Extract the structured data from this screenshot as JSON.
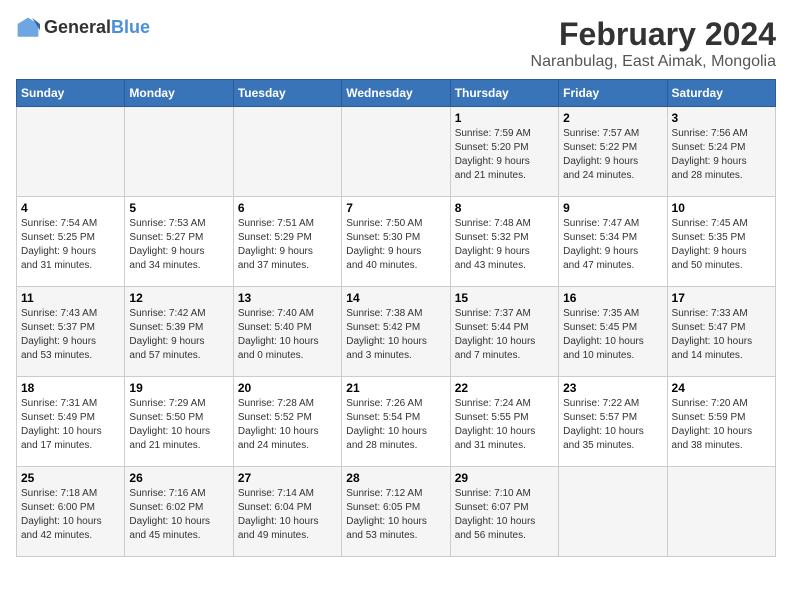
{
  "logo": {
    "general": "General",
    "blue": "Blue"
  },
  "title": "February 2024",
  "subtitle": "Naranbulag, East Aimak, Mongolia",
  "days_header": [
    "Sunday",
    "Monday",
    "Tuesday",
    "Wednesday",
    "Thursday",
    "Friday",
    "Saturday"
  ],
  "weeks": [
    [
      {
        "day": "",
        "detail": ""
      },
      {
        "day": "",
        "detail": ""
      },
      {
        "day": "",
        "detail": ""
      },
      {
        "day": "",
        "detail": ""
      },
      {
        "day": "1",
        "detail": "Sunrise: 7:59 AM\nSunset: 5:20 PM\nDaylight: 9 hours\nand 21 minutes."
      },
      {
        "day": "2",
        "detail": "Sunrise: 7:57 AM\nSunset: 5:22 PM\nDaylight: 9 hours\nand 24 minutes."
      },
      {
        "day": "3",
        "detail": "Sunrise: 7:56 AM\nSunset: 5:24 PM\nDaylight: 9 hours\nand 28 minutes."
      }
    ],
    [
      {
        "day": "4",
        "detail": "Sunrise: 7:54 AM\nSunset: 5:25 PM\nDaylight: 9 hours\nand 31 minutes."
      },
      {
        "day": "5",
        "detail": "Sunrise: 7:53 AM\nSunset: 5:27 PM\nDaylight: 9 hours\nand 34 minutes."
      },
      {
        "day": "6",
        "detail": "Sunrise: 7:51 AM\nSunset: 5:29 PM\nDaylight: 9 hours\nand 37 minutes."
      },
      {
        "day": "7",
        "detail": "Sunrise: 7:50 AM\nSunset: 5:30 PM\nDaylight: 9 hours\nand 40 minutes."
      },
      {
        "day": "8",
        "detail": "Sunrise: 7:48 AM\nSunset: 5:32 PM\nDaylight: 9 hours\nand 43 minutes."
      },
      {
        "day": "9",
        "detail": "Sunrise: 7:47 AM\nSunset: 5:34 PM\nDaylight: 9 hours\nand 47 minutes."
      },
      {
        "day": "10",
        "detail": "Sunrise: 7:45 AM\nSunset: 5:35 PM\nDaylight: 9 hours\nand 50 minutes."
      }
    ],
    [
      {
        "day": "11",
        "detail": "Sunrise: 7:43 AM\nSunset: 5:37 PM\nDaylight: 9 hours\nand 53 minutes."
      },
      {
        "day": "12",
        "detail": "Sunrise: 7:42 AM\nSunset: 5:39 PM\nDaylight: 9 hours\nand 57 minutes."
      },
      {
        "day": "13",
        "detail": "Sunrise: 7:40 AM\nSunset: 5:40 PM\nDaylight: 10 hours\nand 0 minutes."
      },
      {
        "day": "14",
        "detail": "Sunrise: 7:38 AM\nSunset: 5:42 PM\nDaylight: 10 hours\nand 3 minutes."
      },
      {
        "day": "15",
        "detail": "Sunrise: 7:37 AM\nSunset: 5:44 PM\nDaylight: 10 hours\nand 7 minutes."
      },
      {
        "day": "16",
        "detail": "Sunrise: 7:35 AM\nSunset: 5:45 PM\nDaylight: 10 hours\nand 10 minutes."
      },
      {
        "day": "17",
        "detail": "Sunrise: 7:33 AM\nSunset: 5:47 PM\nDaylight: 10 hours\nand 14 minutes."
      }
    ],
    [
      {
        "day": "18",
        "detail": "Sunrise: 7:31 AM\nSunset: 5:49 PM\nDaylight: 10 hours\nand 17 minutes."
      },
      {
        "day": "19",
        "detail": "Sunrise: 7:29 AM\nSunset: 5:50 PM\nDaylight: 10 hours\nand 21 minutes."
      },
      {
        "day": "20",
        "detail": "Sunrise: 7:28 AM\nSunset: 5:52 PM\nDaylight: 10 hours\nand 24 minutes."
      },
      {
        "day": "21",
        "detail": "Sunrise: 7:26 AM\nSunset: 5:54 PM\nDaylight: 10 hours\nand 28 minutes."
      },
      {
        "day": "22",
        "detail": "Sunrise: 7:24 AM\nSunset: 5:55 PM\nDaylight: 10 hours\nand 31 minutes."
      },
      {
        "day": "23",
        "detail": "Sunrise: 7:22 AM\nSunset: 5:57 PM\nDaylight: 10 hours\nand 35 minutes."
      },
      {
        "day": "24",
        "detail": "Sunrise: 7:20 AM\nSunset: 5:59 PM\nDaylight: 10 hours\nand 38 minutes."
      }
    ],
    [
      {
        "day": "25",
        "detail": "Sunrise: 7:18 AM\nSunset: 6:00 PM\nDaylight: 10 hours\nand 42 minutes."
      },
      {
        "day": "26",
        "detail": "Sunrise: 7:16 AM\nSunset: 6:02 PM\nDaylight: 10 hours\nand 45 minutes."
      },
      {
        "day": "27",
        "detail": "Sunrise: 7:14 AM\nSunset: 6:04 PM\nDaylight: 10 hours\nand 49 minutes."
      },
      {
        "day": "28",
        "detail": "Sunrise: 7:12 AM\nSunset: 6:05 PM\nDaylight: 10 hours\nand 53 minutes."
      },
      {
        "day": "29",
        "detail": "Sunrise: 7:10 AM\nSunset: 6:07 PM\nDaylight: 10 hours\nand 56 minutes."
      },
      {
        "day": "",
        "detail": ""
      },
      {
        "day": "",
        "detail": ""
      }
    ]
  ]
}
